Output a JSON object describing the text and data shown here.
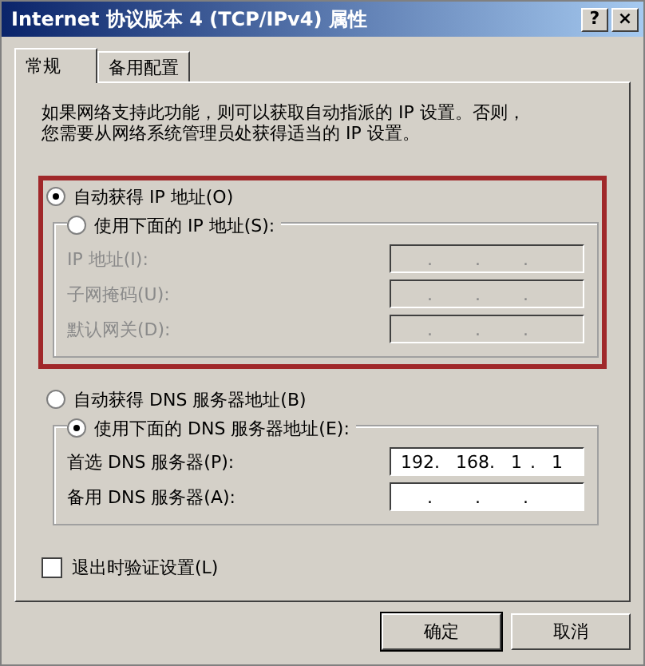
{
  "window": {
    "title": "Internet 协议版本 4 (TCP/IPv4) 属性",
    "help_button": "?",
    "close_button": "×"
  },
  "tabs": [
    {
      "label": "常规",
      "selected": true
    },
    {
      "label": "备用配置",
      "selected": false
    }
  ],
  "description": [
    "如果网络支持此功能，则可以获取自动指派的 IP 设置。否则，",
    "您需要从网络系统管理员处获得适当的 IP 设置。"
  ],
  "octet_separator": ".",
  "ip_section": {
    "highlighted": true,
    "radios": [
      {
        "label": "自动获得 IP 地址(O)",
        "selected": true
      },
      {
        "label": "使用下面的 IP 地址(S):",
        "selected": false
      }
    ],
    "fields": [
      {
        "label": "IP 地址(I):",
        "disabled": true
      },
      {
        "label": "子网掩码(U):",
        "disabled": true
      },
      {
        "label": "默认网关(D):",
        "disabled": true
      }
    ]
  },
  "dns_section": {
    "highlighted": false,
    "radios": [
      {
        "label": "自动获得 DNS 服务器地址(B)",
        "selected": false
      },
      {
        "label": "使用下面的 DNS 服务器地址(E):",
        "selected": true
      }
    ],
    "fields": [
      {
        "label": "首选 DNS 服务器(P):",
        "disabled": false,
        "octets": [
          "192",
          "168",
          "1",
          "1"
        ]
      },
      {
        "label": "备用 DNS 服务器(A):",
        "disabled": false
      }
    ]
  },
  "validate_checkbox": {
    "label": "退出时验证设置(L)",
    "checked": false
  },
  "buttons": [
    "确定",
    "取消"
  ]
}
